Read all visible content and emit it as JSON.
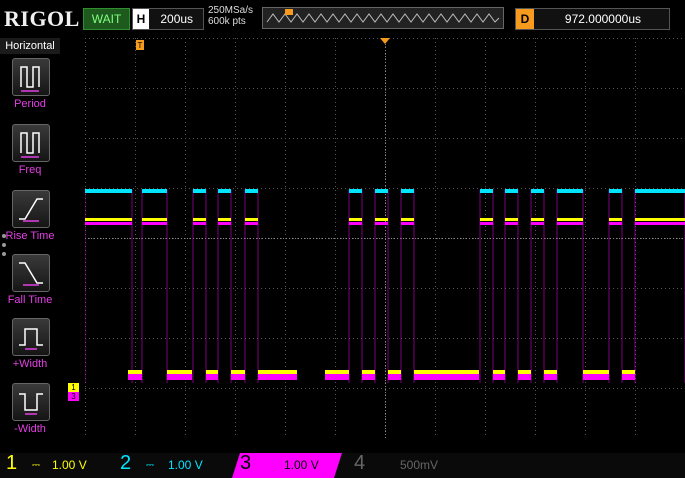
{
  "header": {
    "brand": "RIGOL",
    "status": "WAIT",
    "horizontal": {
      "letter": "H",
      "timebase": "200us"
    },
    "sample_rate": "250MSa/s",
    "memory_depth": "600k pts",
    "delay": {
      "letter": "D",
      "value": "972.000000us"
    }
  },
  "menu": {
    "title": "Horizontal",
    "items": [
      {
        "label": "Period"
      },
      {
        "label": "Freq"
      },
      {
        "label": "Rise Time"
      },
      {
        "label": "Fall Time"
      },
      {
        "label": "+Width"
      },
      {
        "label": "-Width"
      }
    ]
  },
  "channels": [
    {
      "number": "1",
      "scale": "1.00 V",
      "color": "#ffff00",
      "active": true
    },
    {
      "number": "2",
      "scale": "1.00 V",
      "color": "#00e5ff",
      "active": true
    },
    {
      "number": "3",
      "scale": "1.00 V",
      "color": "#ff00ff",
      "active": true
    },
    {
      "number": "4",
      "scale": "500mV",
      "color": "#666666",
      "active": false
    }
  ],
  "markers": {
    "ch1": "1",
    "ch3": "3",
    "trigger": "T"
  },
  "colors": {
    "ch1": "#ffff00",
    "ch2": "#00e5ff",
    "ch3": "#ff00ff",
    "trigger": "#f79b1e",
    "grid": "#555555"
  }
}
